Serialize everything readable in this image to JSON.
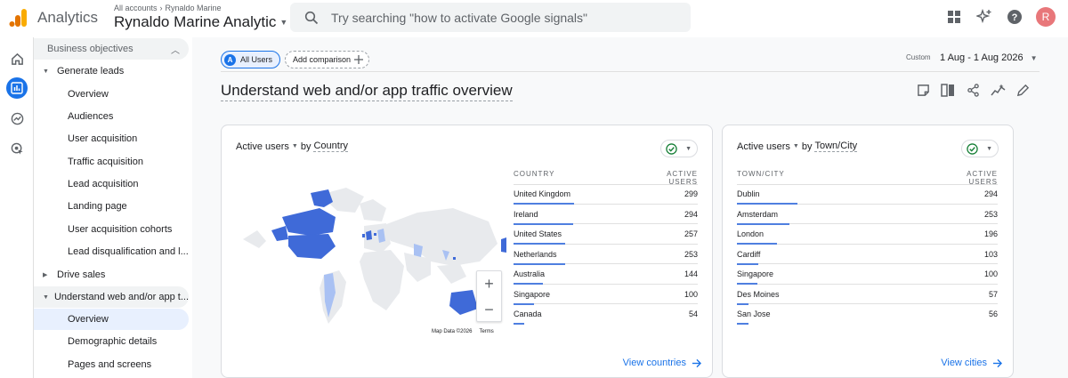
{
  "topbar": {
    "app_name": "Analytics",
    "breadcrumb_root": "All accounts",
    "breadcrumb_account": "Rynaldo Marine",
    "property_name": "Rynaldo Marine Analytic",
    "search_placeholder": "Try searching \"how to activate Google signals\"",
    "avatar_letter": "R",
    "icons": [
      "apps-grid-icon",
      "sparkle-plus-icon",
      "help-icon"
    ]
  },
  "rail": [
    "home-icon",
    "reports-icon",
    "explore-icon",
    "advertising-icon"
  ],
  "nav": {
    "header": "Business objectives",
    "items": [
      {
        "type": "section",
        "label": "Generate leads",
        "expanded": true
      },
      {
        "type": "sub",
        "label": "Overview"
      },
      {
        "type": "sub",
        "label": "Audiences"
      },
      {
        "type": "sub",
        "label": "User acquisition"
      },
      {
        "type": "sub",
        "label": "Traffic acquisition"
      },
      {
        "type": "sub",
        "label": "Lead acquisition"
      },
      {
        "type": "sub",
        "label": "Landing page"
      },
      {
        "type": "sub",
        "label": "User acquisition cohorts"
      },
      {
        "type": "sub",
        "label": "Lead disqualification and l..."
      },
      {
        "type": "section",
        "label": "Drive sales",
        "expanded": false
      },
      {
        "type": "section",
        "label": "Understand web and/or app t...",
        "expanded": true
      },
      {
        "type": "sub",
        "label": "Overview",
        "active": true
      },
      {
        "type": "sub",
        "label": "Demographic details"
      },
      {
        "type": "sub",
        "label": "Pages and screens"
      }
    ]
  },
  "main": {
    "comparison_chip": {
      "badge": "A",
      "label": "All Users"
    },
    "add_comparison": "Add comparison",
    "date_mode": "Custom",
    "date_range": "1 Aug - 1 Aug 2026",
    "page_title": "Understand web and/or app traffic overview",
    "tools": [
      "annotation-icon",
      "compare-columns-icon",
      "share-icon",
      "insights-icon",
      "edit-icon"
    ]
  },
  "country_card": {
    "metric": "Active users",
    "by": "by",
    "dimension": "Country",
    "col_dimension": "COUNTRY",
    "col_metric": "ACTIVE USERS",
    "rows": [
      {
        "name": "United Kingdom",
        "value": "299"
      },
      {
        "name": "Ireland",
        "value": "294"
      },
      {
        "name": "United States",
        "value": "257"
      },
      {
        "name": "Netherlands",
        "value": "253"
      },
      {
        "name": "Australia",
        "value": "144"
      },
      {
        "name": "Singapore",
        "value": "100"
      },
      {
        "name": "Canada",
        "value": "54"
      }
    ],
    "map_data": "Map Data ©2026",
    "map_terms": "Terms",
    "link": "View countries"
  },
  "city_card": {
    "metric": "Active users",
    "by": "by",
    "dimension": "Town/City",
    "col_dimension": "TOWN/CITY",
    "col_metric": "ACTIVE USERS",
    "rows": [
      {
        "name": "Dublin",
        "value": "294"
      },
      {
        "name": "Amsterdam",
        "value": "253"
      },
      {
        "name": "London",
        "value": "196"
      },
      {
        "name": "Cardiff",
        "value": "103"
      },
      {
        "name": "Singapore",
        "value": "100"
      },
      {
        "name": "Des Moines",
        "value": "57"
      },
      {
        "name": "San Jose",
        "value": "56"
      }
    ],
    "link": "View cities"
  },
  "colors": {
    "accent": "#1a73e8",
    "bar": "#4f7fe0",
    "map_dark": "#3f6ad8",
    "map_light": "#a9c1f3",
    "map_none": "#e8eaed"
  }
}
